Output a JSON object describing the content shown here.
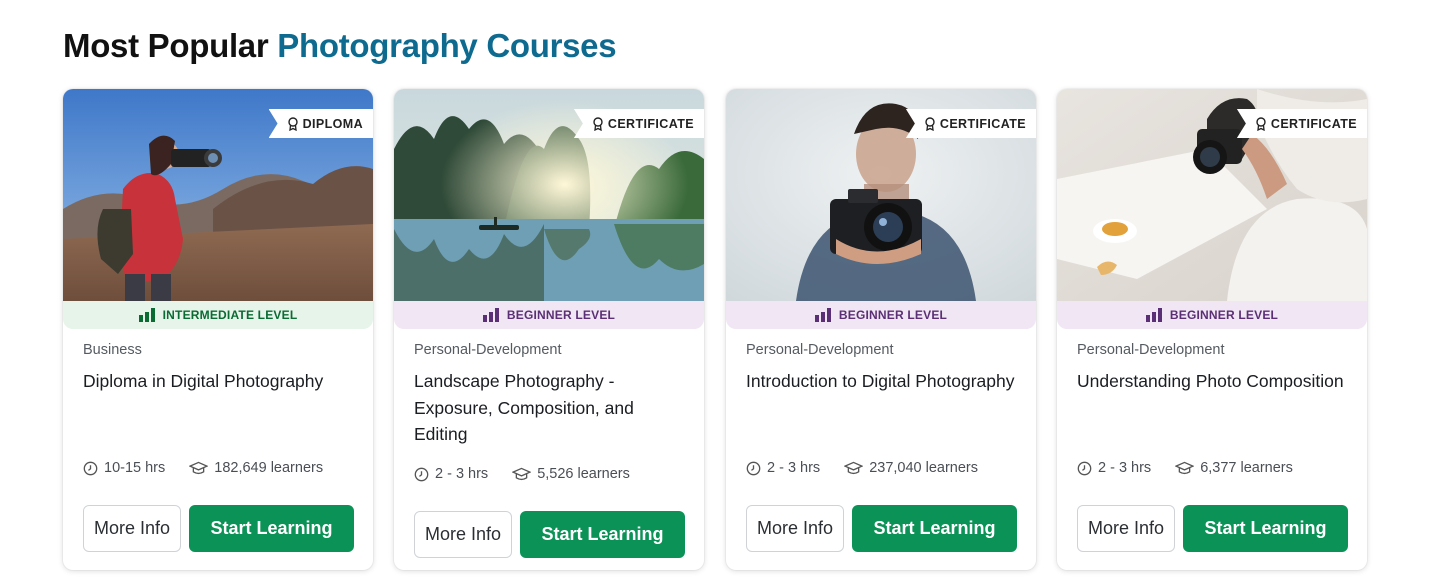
{
  "heading": {
    "part1": "Most Popular",
    "part2": "Photography Courses"
  },
  "colors": {
    "accent_blue": "#0e6a8f",
    "start_green": "#0b9257",
    "intermediate_bg": "#e6f4ea",
    "intermediate_text": "#0a6b33",
    "beginner_bg": "#f1e6f3",
    "beginner_text": "#5b2f76"
  },
  "courses": [
    {
      "badge": "DIPLOMA",
      "level": "INTERMEDIATE LEVEL",
      "category": "Business",
      "title": "Diploma in Digital Photography",
      "duration": "10-15 hrs",
      "learners": "182,649 learners",
      "more_info": "More Info",
      "start": "Start Learning"
    },
    {
      "badge": "CERTIFICATE",
      "level": "BEGINNER LEVEL",
      "category": "Personal-Development",
      "title": "Landscape Photography - Exposure, Composition, and Editing",
      "duration": "2 - 3 hrs",
      "learners": "5,526 learners",
      "more_info": "More Info",
      "start": "Start Learning"
    },
    {
      "badge": "CERTIFICATE",
      "level": "BEGINNER LEVEL",
      "category": "Personal-Development",
      "title": "Introduction to Digital Photography",
      "duration": "2 - 3 hrs",
      "learners": "237,040 learners",
      "more_info": "More Info",
      "start": "Start Learning"
    },
    {
      "badge": "CERTIFICATE",
      "level": "BEGINNER LEVEL",
      "category": "Personal-Development",
      "title": "Understanding Photo Composition",
      "duration": "2 - 3 hrs",
      "learners": "6,377 learners",
      "more_info": "More Info",
      "start": "Start Learning"
    }
  ],
  "icons": {
    "badge": "award-ribbon-icon",
    "level": "bar-chart-icon",
    "duration": "clock-icon",
    "learners": "graduation-cap-icon"
  }
}
